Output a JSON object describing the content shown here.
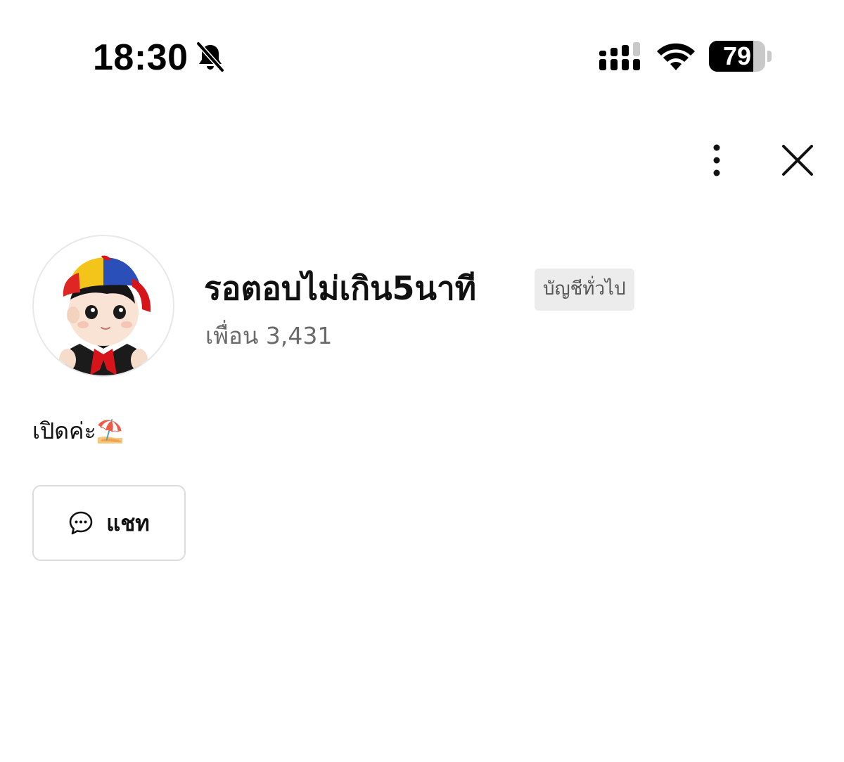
{
  "status_bar": {
    "time": "18:30",
    "battery_level": 79,
    "battery_label": "79",
    "icons": [
      "bell-slash-icon",
      "signal-icon",
      "wifi-icon",
      "battery-icon"
    ]
  },
  "header": {
    "more_icon": "more-vertical-icon",
    "close_icon": "close-icon"
  },
  "profile": {
    "name": "รอตอบไม่เกิน5นาที",
    "badge": "บัญชีทั่วไป",
    "friends_label": "เพื่อน",
    "friends_count": "3,431",
    "status_message": "เปิดค่ะ⛱️"
  },
  "actions": {
    "chat_label": "แชท",
    "chat_icon": "chat-bubble-icon"
  },
  "colors": {
    "badge_bg": "#ececec",
    "muted_text": "#6a6a6a",
    "border": "#dcdcdc"
  }
}
